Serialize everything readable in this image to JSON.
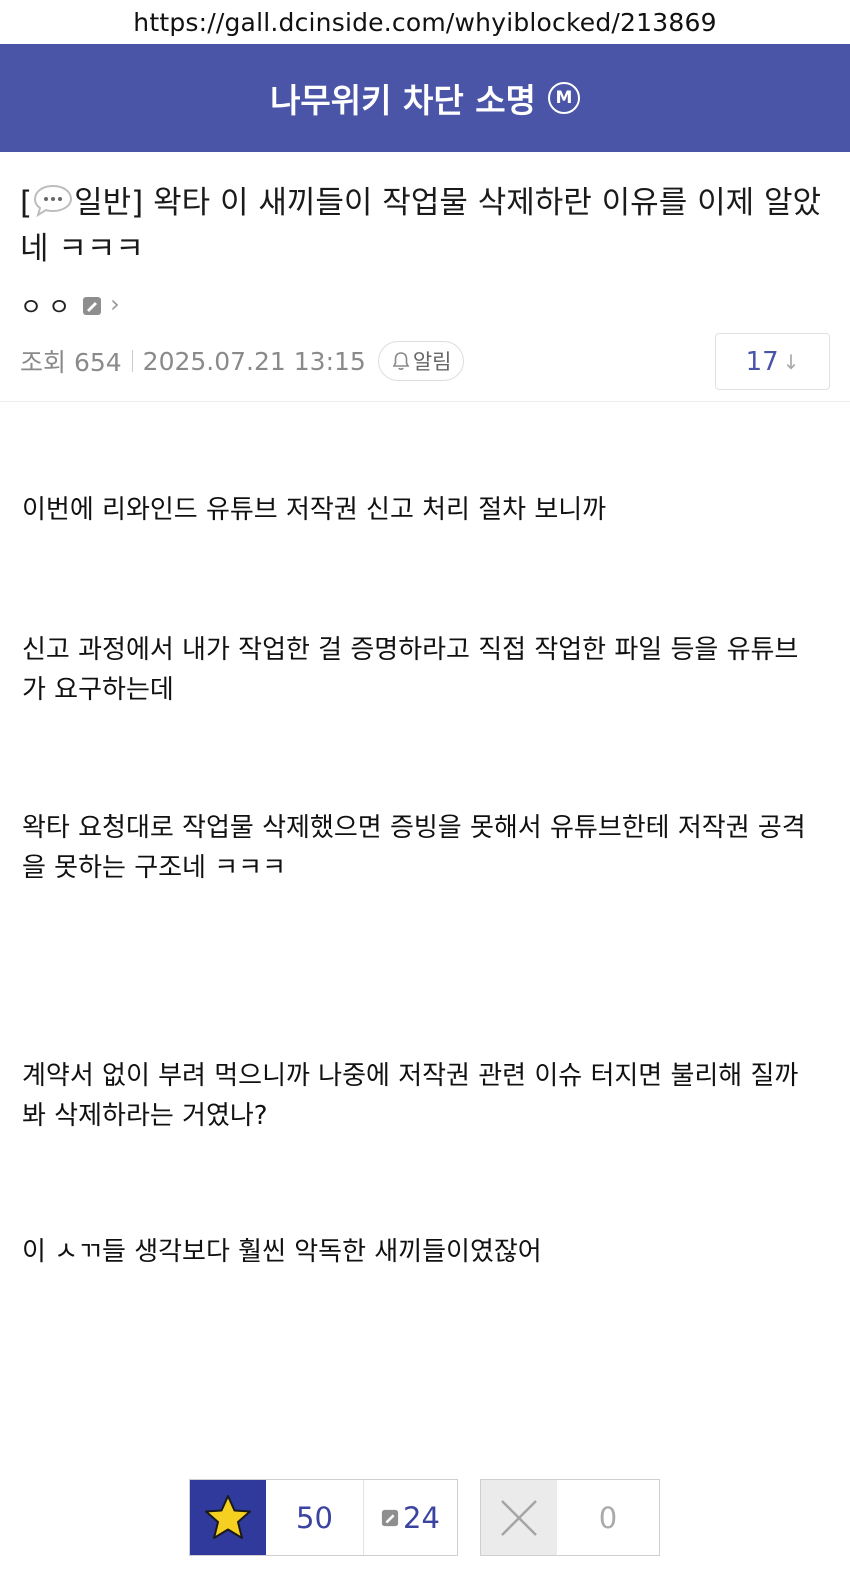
{
  "browser": {
    "url": "https://gall.dcinside.com/whyiblocked/213869"
  },
  "gallery": {
    "title": "나무위키 차단 소명",
    "badge": "M"
  },
  "post": {
    "title_prefix": "[",
    "category": "일반]",
    "title": " 왁타 이 새끼들이 작업물 삭제하란 이유를 이제 알았네 ㅋㅋㅋ",
    "author": "ㅇㅇ",
    "views_label": "조회 654",
    "date": "2025.07.21 13:15",
    "alarm_label": "알림",
    "comment_count": "17",
    "comment_arrow": "↓",
    "paragraphs": [
      "이번에 리와인드 유튜브 저작권 신고 처리 절차 보니까",
      "신고 과정에서 내가 작업한 걸 증명하라고 직접 작업한 파일 등을 유튜브가 요구하는데",
      "왁타 요청대로 작업물 삭제했으면 증빙을 못해서 유튜브한테 저작권 공격을 못하는 구조네 ㅋㅋㅋ",
      "계약서 없이 부려 먹으니까 나중에 저작권 관련 이슈 터지면 불리해 질까봐 삭제하라는 거였나?",
      "이 ㅅㄲ들 생각보다 훨씬 악독한 새끼들이였잖어"
    ]
  },
  "votes": {
    "recommend": "50",
    "fixed_recommend": "24",
    "not_recommend": "0"
  },
  "colors": {
    "header_bg": "#4a55a8",
    "star_bg": "#2f3a9c",
    "star": "#f5d020"
  },
  "icons": [
    "speech-bubble-icon",
    "fixed-nick-icon",
    "chevron-right-icon",
    "bell-icon",
    "star-icon",
    "x-icon"
  ]
}
